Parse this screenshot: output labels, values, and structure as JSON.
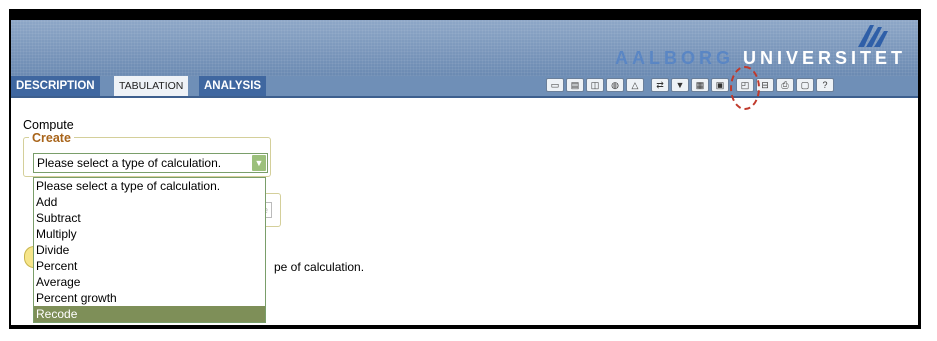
{
  "brand": {
    "part1": "AALBORG",
    "part2": "UNIVERSITET"
  },
  "tabs": [
    {
      "label": "DESCRIPTION"
    },
    {
      "label": "TABULATION"
    },
    {
      "label": "ANALYSIS"
    }
  ],
  "toolbar": {
    "icons": [
      "table-icon",
      "layout-icon",
      "chart-icon",
      "map-icon",
      "map2-icon",
      "swap-icon",
      "filter-icon",
      "compute-icon",
      "save-icon",
      "print-preview-icon",
      "export-icon",
      "print-icon",
      "open-folder-icon",
      "help-icon"
    ]
  },
  "compute": {
    "heading": "Compute",
    "create_legend": "Create",
    "select_value": "Please select a type of calculation.",
    "options": [
      "Please select a type of calculation.",
      "Add",
      "Subtract",
      "Multiply",
      "Divide",
      "Percent",
      "Average",
      "Percent growth",
      "Recode"
    ],
    "selected_option": "Recode",
    "hint_partial": "pe of calculation."
  }
}
